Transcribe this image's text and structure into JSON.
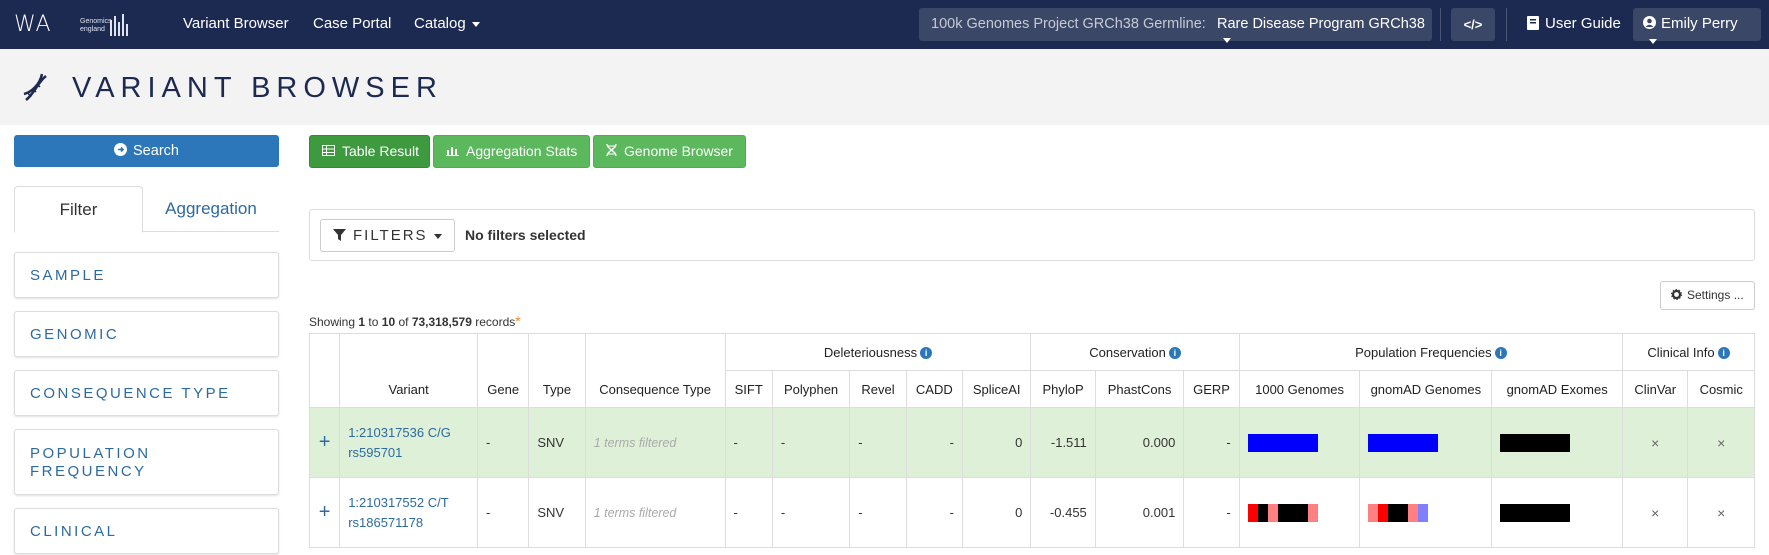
{
  "nav": {
    "logo_text": "WA",
    "brand_small": "Genomics england",
    "links": [
      "Variant Browser",
      "Case Portal",
      "Catalog"
    ],
    "project_label": "100k Genomes Project GRCh38 Germline:",
    "project_value": "Rare Disease Program GRCh38",
    "code_icon": "</>",
    "user_guide": "User Guide",
    "user_name": "Emily Perry"
  },
  "page": {
    "title": "VARIANT BROWSER"
  },
  "sidebar": {
    "search_label": "Search",
    "tabs": [
      "Filter",
      "Aggregation"
    ],
    "sections": [
      "SAMPLE",
      "GENOMIC",
      "CONSEQUENCE TYPE",
      "POPULATION FREQUENCY",
      "CLINICAL"
    ]
  },
  "toolbar": {
    "buttons": [
      "Table Result",
      "Aggregation Stats",
      "Genome Browser"
    ]
  },
  "filters": {
    "button_label": "FILTERS",
    "status": "No filters selected"
  },
  "settings_label": "Settings ...",
  "records": {
    "prefix": "Showing",
    "from": "1",
    "to_word": "to",
    "to": "10",
    "of_word": "of",
    "total": "73,318,579",
    "suffix": "records",
    "asterisk": "*"
  },
  "table": {
    "group_headers": [
      "Deleteriousness",
      "Conservation",
      "Population Frequencies",
      "Clinical Info"
    ],
    "columns": [
      "Variant",
      "Gene",
      "Type",
      "Consequence Type",
      "SIFT",
      "Polyphen",
      "Revel",
      "CADD",
      "SpliceAI",
      "PhyloP",
      "PhastCons",
      "GERP",
      "1000 Genomes",
      "gnomAD Genomes",
      "gnomAD Exomes",
      "ClinVar",
      "Cosmic"
    ],
    "rows": [
      {
        "expand": "+",
        "variant": "1:210317536 C/G",
        "rsid": "rs595701",
        "gene": "-",
        "type": "SNV",
        "consequence": "1 terms filtered",
        "sift": "-",
        "polyphen": "-",
        "revel": "-",
        "cadd": "-",
        "spliceai": "0",
        "phylop": "-1.511",
        "phastcons": "0.000",
        "gerp": "-",
        "freq_1000g": [
          "#0000ff",
          "#0000ff",
          "#0000ff",
          "#0000ff",
          "#0000ff",
          "#0000ff",
          "#0000ff"
        ],
        "freq_gnomad_genomes": [
          "#0000ff",
          "#0000ff",
          "#0000ff",
          "#0000ff",
          "#0000ff",
          "#0000ff",
          "#0000ff"
        ],
        "freq_gnomad_exomes": [
          "#000000",
          "#000000",
          "#000000",
          "#000000",
          "#000000",
          "#000000",
          "#000000"
        ],
        "clinvar": "×",
        "cosmic": "×"
      },
      {
        "expand": "+",
        "variant": "1:210317552 C/T",
        "rsid": "rs186571178",
        "gene": "-",
        "type": "SNV",
        "consequence": "1 terms filtered",
        "sift": "-",
        "polyphen": "-",
        "revel": "-",
        "cadd": "-",
        "spliceai": "0",
        "phylop": "-0.455",
        "phastcons": "0.001",
        "gerp": "-",
        "freq_1000g": [
          "#ff0000",
          "#000000",
          "#ff8080",
          "#000000",
          "#000000",
          "#000000",
          "#ff8080"
        ],
        "freq_gnomad_genomes": [
          "#ff8080",
          "#ff0000",
          "#000000",
          "#000000",
          "#ff8080",
          "#8080ff",
          "#ffffff"
        ],
        "freq_gnomad_exomes": [
          "#000000",
          "#000000",
          "#000000",
          "#000000",
          "#000000",
          "#000000",
          "#000000"
        ],
        "clinvar": "×",
        "cosmic": "×"
      }
    ]
  },
  "colors": {
    "navbar": "#1c2a52",
    "primary": "#2c77ba",
    "success": "#5cb85c",
    "row_highlight": "#dff0d8"
  }
}
